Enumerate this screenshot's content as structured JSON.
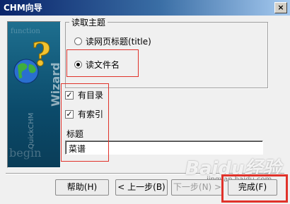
{
  "window": {
    "title": "CHM向导",
    "close_glyph": "×"
  },
  "sidebar": {
    "ghost_text_top": "function",
    "ghost_text_bottom": "begin",
    "vertical_title": "Wizard",
    "vertical_sub": "QuickCHM",
    "icon": "globe-question-icon"
  },
  "topic_group": {
    "label": "读取主题",
    "options": [
      {
        "label": "读网页标题(title)",
        "selected": false
      },
      {
        "label": "读文件名",
        "selected": true
      }
    ]
  },
  "checks": [
    {
      "label": "有目录",
      "checked": true
    },
    {
      "label": "有索引",
      "checked": true
    }
  ],
  "title_field": {
    "label": "标题",
    "value": "菜谱"
  },
  "buttons": {
    "help": "帮助(H)",
    "back": "< 上一步(B)",
    "next": "下一步(N) >",
    "finish": "完成(F)"
  },
  "watermark": {
    "brand": "Baidu经验",
    "url": "jingyan.baidu.com"
  },
  "colors": {
    "highlight": "#e0322a",
    "titlebar": "#0a246a"
  }
}
